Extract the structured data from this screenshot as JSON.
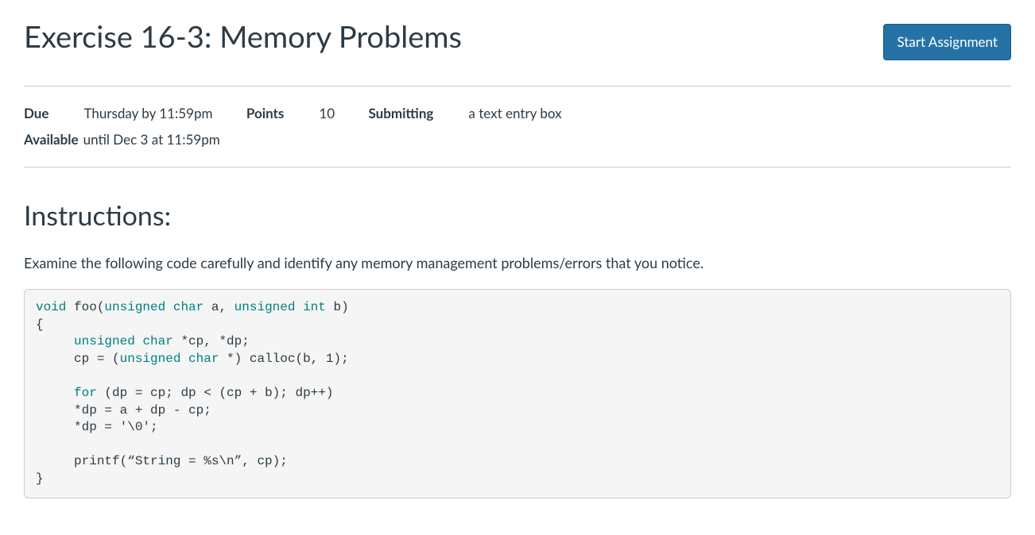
{
  "header": {
    "title": "Exercise 16-3: Memory Problems",
    "start_button": "Start Assignment"
  },
  "meta": {
    "due_label": "Due",
    "due_value": "Thursday by 11:59pm",
    "points_label": "Points",
    "points_value": "10",
    "submitting_label": "Submitting",
    "submitting_value": "a text entry box",
    "available_label": "Available",
    "available_value": "until Dec 3 at 11:59pm"
  },
  "instructions": {
    "heading": "Instructions:",
    "intro": "Examine the following code carefully and identify any memory management problems/errors that you notice.",
    "code": {
      "l1a": "void",
      "l1b": " foo(",
      "l1c": "unsigned",
      "l1d": " ",
      "l1e": "char",
      "l1f": " a, ",
      "l1g": "unsigned",
      "l1h": " ",
      "l1i": "int",
      "l1j": " b)",
      "l2": "{",
      "l3a": "     ",
      "l3b": "unsigned",
      "l3c": " ",
      "l3d": "char",
      "l3e": " *cp, *dp;",
      "l4a": "     cp = (",
      "l4b": "unsigned",
      "l4c": " ",
      "l4d": "char",
      "l4e": " *) calloc(b, 1);",
      "l5": "",
      "l6a": "     ",
      "l6b": "for",
      "l6c": " (dp = cp; dp < (cp + b); dp++)",
      "l7": "     *dp = a + dp - cp;",
      "l8": "     *dp = '\\0';",
      "l9": "",
      "l10": "     printf(“String = %s\\n”, cp);",
      "l11": "}"
    }
  }
}
